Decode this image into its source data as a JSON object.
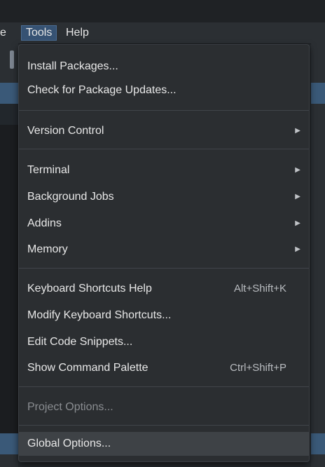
{
  "menubar": {
    "partial_label": "e",
    "tools_label": "Tools",
    "help_label": "Help"
  },
  "tools_menu": {
    "install_packages": "Install Packages...",
    "check_updates": "Check for Package Updates...",
    "version_control": "Version Control",
    "terminal": "Terminal",
    "background_jobs": "Background Jobs",
    "addins": "Addins",
    "memory": "Memory",
    "keyboard_help": "Keyboard Shortcuts Help",
    "keyboard_help_shortcut": "Alt+Shift+K",
    "modify_shortcuts": "Modify Keyboard Shortcuts...",
    "edit_snippets": "Edit Code Snippets...",
    "command_palette": "Show Command Palette",
    "command_palette_shortcut": "Ctrl+Shift+P",
    "project_options": "Project Options...",
    "global_options": "Global Options..."
  },
  "colors": {
    "accent": "#365273",
    "menu_bg": "#2b2e31",
    "highlight": "#3e4246"
  }
}
